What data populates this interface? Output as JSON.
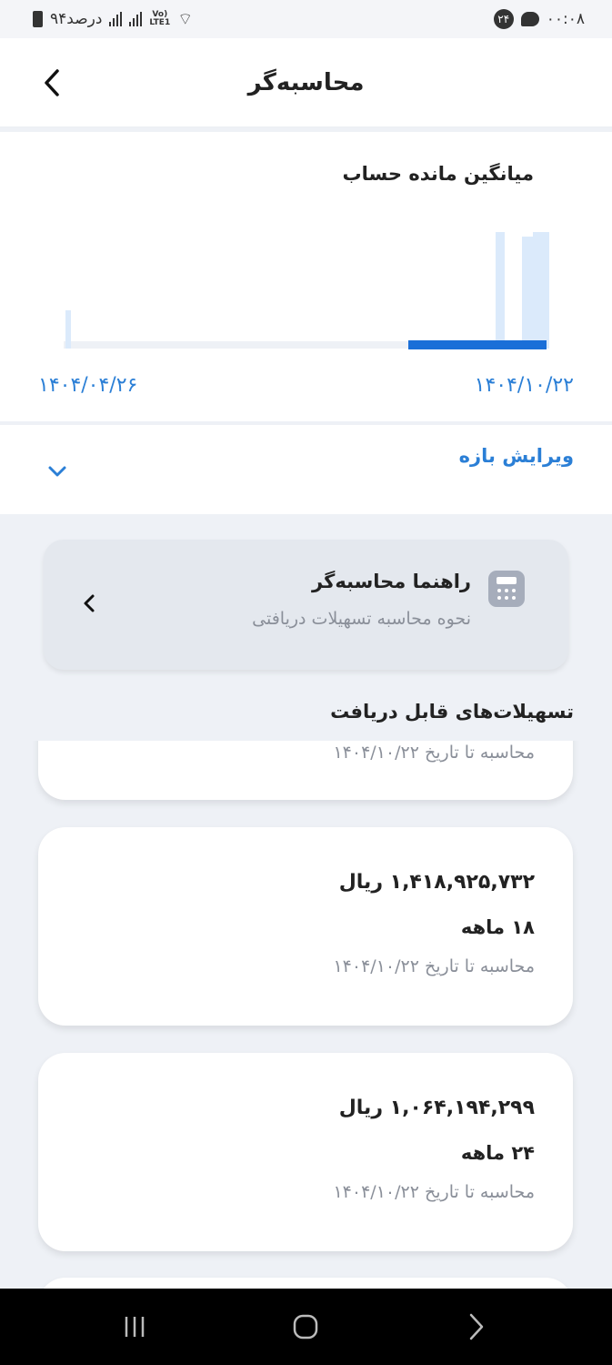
{
  "status_bar": {
    "time": "۰۰:۰۸",
    "notification_count": "۲۴",
    "battery_text": "۹۴درصد",
    "network": "Vo) LTE1"
  },
  "header": {
    "title": "محاسبه‌گر"
  },
  "chart": {
    "title": "میانگین مانده حساب",
    "date_start": "۱۴۰۴/۰۴/۲۶",
    "date_end": "۱۴۰۴/۱۰/۲۲",
    "colors": {
      "bar": "#dbeafb",
      "highlight": "#1a6fd8",
      "baseline": "#eef1f6"
    }
  },
  "range": {
    "label": "ویرایش بازه"
  },
  "guide": {
    "title": "راهنما محاسبه‌گر",
    "subtitle": "نحوه محاسبه تسهیلات دریافتی"
  },
  "loans": {
    "section_title": "تسهیلات‌های قابل دریافت",
    "partial_top_date": "محاسبه تا تاریخ ۱۴۰۴/۱۰/۲۲",
    "items": [
      {
        "amount": "۱,۴۱۸,۹۲۵,۷۳۲ ریال",
        "term": "۱۸ ماهه",
        "date": "محاسبه تا تاریخ ۱۴۰۴/۱۰/۲۲"
      },
      {
        "amount": "۱,۰۶۴,۱۹۴,۲۹۹ ریال",
        "term": "۲۴ ماهه",
        "date": "محاسبه تا تاریخ ۱۴۰۴/۱۰/۲۲"
      }
    ]
  },
  "accent_color": "#2b7fd6"
}
